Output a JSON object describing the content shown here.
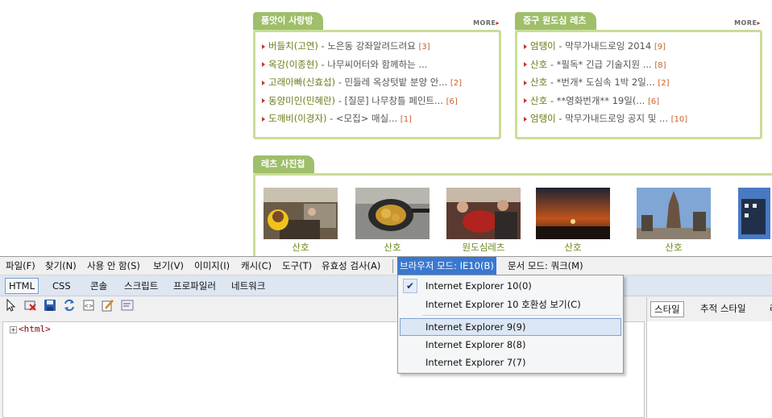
{
  "web": {
    "board1": {
      "title": "품앗이 사랑방",
      "more": "MORE",
      "items": [
        {
          "author": "버들치(고연)",
          "text": " - 노은동 강좌알려드려요 ",
          "count": "[3]"
        },
        {
          "author": "옥강(이종현)",
          "text": " - 나무씨어터와 함께하는 ...",
          "count": ""
        },
        {
          "author": "고래아빠(신효섭)",
          "text": " - 민들레 옥상텃밭 분양 안... ",
          "count": "[2]"
        },
        {
          "author": "동양미인(민혜란)",
          "text": " - [질문] 나무창틀 페인트... ",
          "count": "[6]"
        },
        {
          "author": "도깨비(이경자)",
          "text": " - <모집> 매실... ",
          "count": "[1]"
        }
      ]
    },
    "board2": {
      "title": "중구 원도심 레츠",
      "more": "MORE",
      "items": [
        {
          "author": "엄탱이",
          "text": " - 막무가내드로잉 2014 ",
          "count": "[9]"
        },
        {
          "author": "산호",
          "text": " - *필독* 긴급 기술지원 ... ",
          "count": "[8]"
        },
        {
          "author": "산호",
          "text": " - *번개* 도심속 1박 2일... ",
          "count": "[2]"
        },
        {
          "author": "산호",
          "text": " - **영화번개** 19일(... ",
          "count": "[6]"
        },
        {
          "author": "엄탱이",
          "text": " - 막무가내드로잉 공지 및 ... ",
          "count": "[10]"
        }
      ]
    },
    "photos": {
      "title": "레츠 사진첩",
      "items": [
        {
          "caption": "산호"
        },
        {
          "caption": "산호"
        },
        {
          "caption": "원도심레츠"
        },
        {
          "caption": "산호"
        },
        {
          "caption": "산호"
        },
        {
          "caption": ""
        }
      ]
    }
  },
  "devtools": {
    "menu": {
      "file": "파일(F)",
      "find": "찾기(N)",
      "disable": "사용 안 함(S)",
      "view": "보기(V)",
      "images": "이미지(I)",
      "cache": "캐시(C)",
      "tools": "도구(T)",
      "validate": "유효성 검사(A)",
      "browser_mode": "브라우저 모드: IE10(B)",
      "document_mode": "문서 모드: 쿼크(M)"
    },
    "tabs": {
      "html": "HTML",
      "css": "CSS",
      "console": "콘솔",
      "script": "스크립트",
      "profiler": "프로파일러",
      "network": "네트워크"
    },
    "tree": {
      "root": "<html>",
      "expander": "+"
    },
    "side_tabs": {
      "style": "스타일",
      "trace": "추적 스타일",
      "overflow": "레"
    },
    "dropdown": {
      "check": "✔",
      "items": {
        "ie10": "Internet Explorer 10(0)",
        "ie10_compat": "Internet Explorer 10 호환성 보기(C)",
        "ie9": "Internet Explorer 9(9)",
        "ie8": "Internet Explorer 8(8)",
        "ie7": "Internet Explorer 7(7)"
      }
    }
  }
}
